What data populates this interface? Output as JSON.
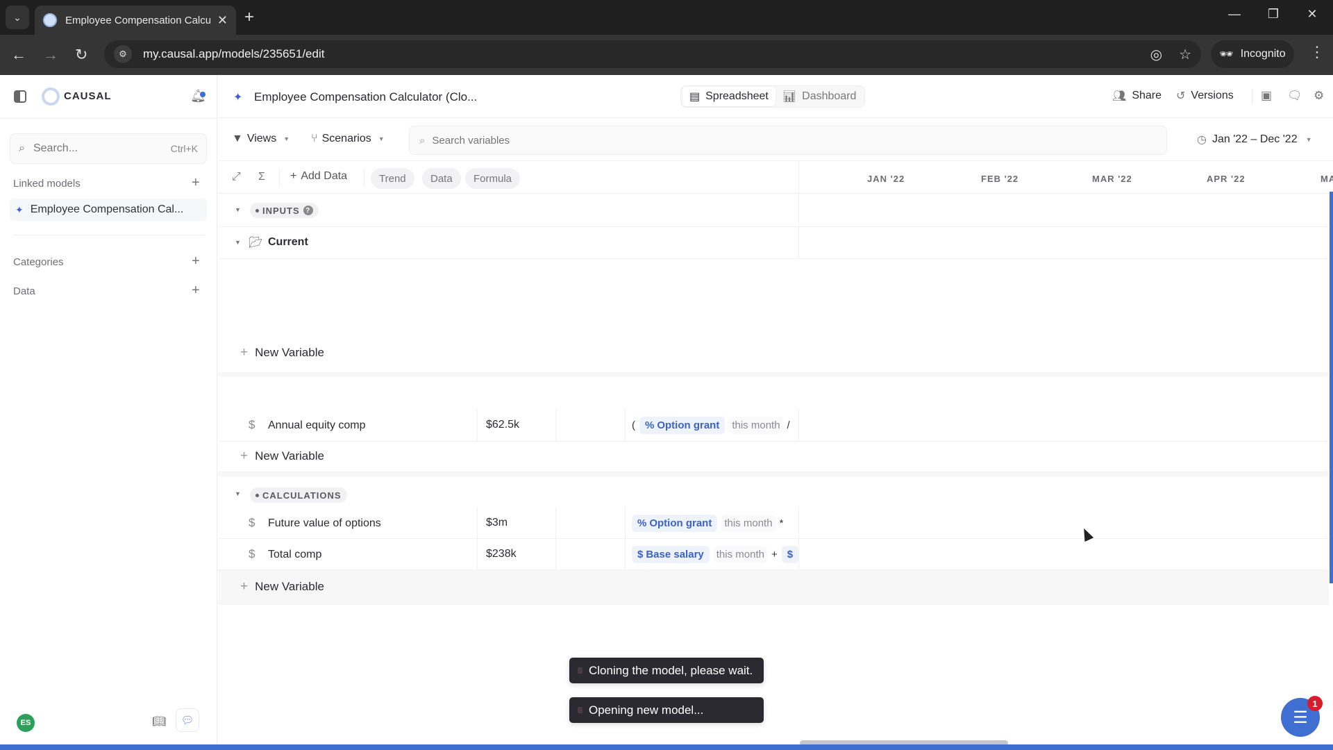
{
  "browser": {
    "tab_title": "Employee Compensation Calcu",
    "url": "my.causal.app/models/235651/edit",
    "incognito_label": "Incognito",
    "window_controls": {
      "minimize": "—",
      "maximize": "❐",
      "close": "✕"
    }
  },
  "sidebar": {
    "logo_text": "CAUSAL",
    "search_placeholder": "Search...",
    "search_shortcut": "Ctrl+K",
    "linked_models_label": "Linked models",
    "linked_models": [
      {
        "label": "Employee Compensation Cal..."
      }
    ],
    "categories_label": "Categories",
    "data_label": "Data",
    "avatar_initials": "ES"
  },
  "header": {
    "model_title": "Employee Compensation Calculator (Clo...",
    "views": [
      {
        "label": "Spreadsheet",
        "active": true
      },
      {
        "label": "Dashboard",
        "active": false
      }
    ],
    "share_label": "Share",
    "versions_label": "Versions"
  },
  "toolbar": {
    "views_label": "Views",
    "scenarios_label": "Scenarios",
    "search_placeholder": "Search variables",
    "date_range": "Jan '22 – Dec '22"
  },
  "column_header": {
    "add_data_label": "Add Data",
    "pills": [
      "Trend",
      "Data",
      "Formula"
    ],
    "months": [
      "JAN '22",
      "FEB '22",
      "MAR '22",
      "APR '22",
      "MA"
    ]
  },
  "grid": {
    "inputs_group": {
      "label": "INPUTS",
      "folder": "Current"
    },
    "new_variable_label": "New Variable",
    "inputs_variables": [
      {
        "name": "Annual equity comp",
        "value": "$62.5k",
        "formula": {
          "prefix": "(",
          "ref_symbol": "%",
          "ref": "Option grant",
          "period": "this month",
          "op": "/"
        }
      }
    ],
    "calculations_group": {
      "label": "CALCULATIONS"
    },
    "calculations_variables": [
      {
        "name": "Future value of options",
        "value": "$3m",
        "formula": {
          "prefix": "",
          "ref_symbol": "%",
          "ref": "Option grant",
          "period": "this month",
          "op": "*"
        }
      },
      {
        "name": "Total comp",
        "value": "$238k",
        "formula": {
          "prefix": "",
          "ref_symbol": "$",
          "ref": "Base salary",
          "period": "this month",
          "op": "+",
          "trailing": "$"
        }
      }
    ]
  },
  "toasts": [
    "Cloning the model, please wait.",
    "Opening new model..."
  ],
  "help_badge_count": "1",
  "colors": {
    "accent": "#3f6fd0",
    "ref_text": "#3a63c4",
    "ref_bg": "#eef2fb",
    "toast_bg": "#2b2a30",
    "avatar": "#2aa05a",
    "badge": "#d81c2a"
  }
}
